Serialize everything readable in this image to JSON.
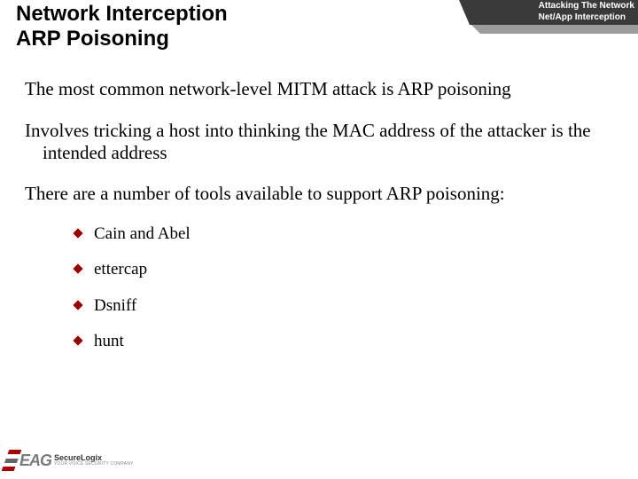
{
  "header": {
    "title": "Network Interception\nARP Poisoning",
    "tag_line1": "Attacking The Network",
    "tag_line2": "Net/App Interception"
  },
  "body": {
    "para1": "The most common network-level MITM attack is ARP poisoning",
    "para2": "Involves tricking a host into thinking the MAC address of the attacker is the intended address",
    "para3": "There are a number of tools available to support ARP poisoning:",
    "tools": [
      "Cain and Abel",
      "ettercap",
      "Dsniff",
      "hunt"
    ]
  },
  "logo": {
    "eag": "EAG",
    "brand": "SecureLogix",
    "tagline": "YOUR VOICE SECURITY COMPANY"
  },
  "colors": {
    "bullet": "#9a0000",
    "tag_dark": "#3a3a3a",
    "tag_light": "#9c9c9c"
  }
}
